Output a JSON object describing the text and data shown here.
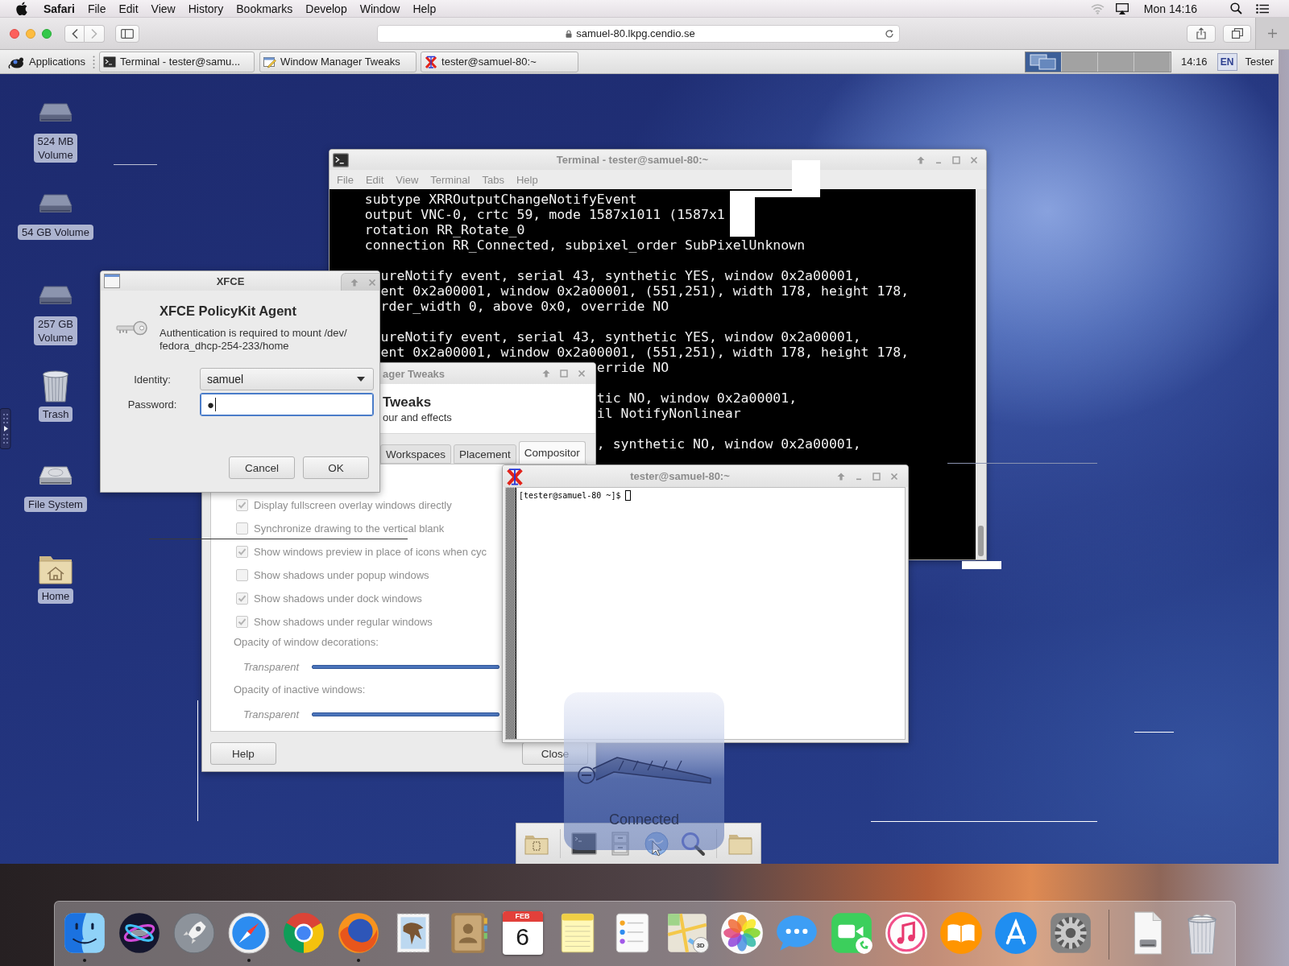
{
  "menu_bar": {
    "app": "Safari",
    "menus": [
      "File",
      "Edit",
      "View",
      "History",
      "Bookmarks",
      "Develop",
      "Window",
      "Help"
    ],
    "clock": "Mon 14:16"
  },
  "browser": {
    "address": "samuel-80.lkpg.cendio.se"
  },
  "xfce_panel": {
    "menu_label": "Applications",
    "tasks": [
      {
        "label": "Terminal - tester@samu...",
        "kind": "terminal"
      },
      {
        "label": "Window Manager Tweaks",
        "kind": "tweaks"
      },
      {
        "label": "tester@samuel-80:~",
        "kind": "xterm"
      }
    ],
    "workspaces": [
      {
        "selected": true
      },
      {
        "selected": false
      },
      {
        "selected": false
      },
      {
        "selected": false
      }
    ],
    "clock": "14:16",
    "keyboard_layout": "EN",
    "user": "Tester"
  },
  "desktop_icons": [
    {
      "label": "524 MB\nVolume",
      "kind": "drive"
    },
    {
      "label": "54 GB Volume",
      "kind": "drive"
    },
    {
      "label": "257 GB\nVolume",
      "kind": "drive"
    },
    {
      "label": "Trash",
      "kind": "trash"
    },
    {
      "label": "File System",
      "kind": "disk"
    },
    {
      "label": "Home",
      "kind": "home"
    }
  ],
  "terminal": {
    "title": "Terminal - tester@samuel-80:~",
    "active": false,
    "menus": [
      "File",
      "Edit",
      "View",
      "Terminal",
      "Tabs",
      "Help"
    ],
    "lines": [
      {
        "kind": "indented",
        "text": "subtype XRROutputChangeNotifyEvent"
      },
      {
        "kind": "indented",
        "text": "output VNC-0, crtc 59, mode 1587x1011 (1587x1"
      },
      {
        "kind": "indented",
        "text": "rotation RR_Rotate_0"
      },
      {
        "kind": "indented",
        "text": "connection RR_Connected, subpixel_order SubPixelUnknown"
      },
      {
        "kind": "blank"
      },
      {
        "kind": "clipped",
        "text": "ureNotify event, serial 43, synthetic YES, window 0x2a00001,"
      },
      {
        "kind": "clipped",
        "text": "ent 0x2a00001, window 0x2a00001, (551,251), width 178, height 178,"
      },
      {
        "kind": "clipped",
        "text": "rder_width 0, above 0x0, override NO"
      },
      {
        "kind": "blank"
      },
      {
        "kind": "clipped",
        "text": "ureNotify event, serial 43, synthetic YES, window 0x2a00001,"
      },
      {
        "kind": "clipped",
        "text": "ent 0x2a00001, window 0x2a00001, (551,251), width 178, height 178,"
      },
      {
        "kind": "tail",
        "text": "erride NO"
      },
      {
        "kind": "blank"
      },
      {
        "kind": "tail",
        "text": "tic NO, window 0x2a00001,"
      },
      {
        "kind": "tail",
        "text": "il NotifyNonlinear"
      },
      {
        "kind": "blank"
      },
      {
        "kind": "tail",
        "text": ", synthetic NO, window 0x2a00001,"
      }
    ]
  },
  "policykit_dialog": {
    "title": "XFCE",
    "active": true,
    "heading": "XFCE PolicyKit Agent",
    "message": "Authentication is required to mount /dev/\nfedora_dhcp-254-233/home",
    "fields": [
      {
        "label": "Identity:",
        "value": "samuel",
        "kind": "combo",
        "focused": false
      },
      {
        "label": "Password:",
        "value": "●",
        "kind": "password",
        "focused": true
      }
    ],
    "buttons": [
      "Cancel",
      "OK"
    ]
  },
  "tweaks_window": {
    "title": "ager Tweaks",
    "active": false,
    "heading": "Tweaks",
    "subheading": "our and effects",
    "tabs": [
      {
        "label": "Workspaces",
        "selected": false
      },
      {
        "label": "Placement",
        "selected": false
      },
      {
        "label": "Compositor",
        "selected": true
      }
    ],
    "options": [
      {
        "label": "Display fullscreen overlay windows directly",
        "checked": true,
        "disabled": true
      },
      {
        "label": "Synchronize drawing to the vertical blank",
        "checked": false,
        "disabled": true
      },
      {
        "label": "Show windows preview in place of icons when cyc",
        "checked": true,
        "disabled": true
      },
      {
        "label": "Show shadows under popup windows",
        "checked": false,
        "disabled": true
      },
      {
        "label": "Show shadows under dock windows",
        "checked": true,
        "disabled": true
      },
      {
        "label": "Show shadows under regular windows",
        "checked": true,
        "disabled": true
      }
    ],
    "sliders": [
      {
        "label": "Opacity of window decorations:",
        "min_label": "Transparent"
      },
      {
        "label": "Opacity of inactive windows:",
        "min_label": "Transparent"
      }
    ],
    "buttons": [
      "Help",
      "Close"
    ]
  },
  "xterm": {
    "title": "tester@samuel-80:~",
    "active": false,
    "prompt": "[tester@samuel-80 ~]$"
  },
  "vnc_notice": {
    "text": "Connected"
  },
  "launcher": {
    "items": [
      {
        "kind": "documents"
      },
      {
        "kind": "separator"
      },
      {
        "kind": "terminal"
      },
      {
        "kind": "cabinet"
      },
      {
        "kind": "browser"
      },
      {
        "kind": "search"
      },
      {
        "kind": "separator"
      },
      {
        "kind": "folder"
      }
    ]
  },
  "dock": {
    "items": [
      {
        "kind": "finder",
        "running": true
      },
      {
        "kind": "siri",
        "running": false
      },
      {
        "kind": "launchpad",
        "running": false
      },
      {
        "kind": "safari",
        "running": true
      },
      {
        "kind": "chrome",
        "running": false
      },
      {
        "kind": "firefox",
        "running": true
      },
      {
        "kind": "mail",
        "running": false
      },
      {
        "kind": "contacts",
        "running": false
      },
      {
        "kind": "calendar",
        "running": false,
        "month": "FEB",
        "day": "6"
      },
      {
        "kind": "notes",
        "running": false
      },
      {
        "kind": "reminders",
        "running": false
      },
      {
        "kind": "maps",
        "running": false,
        "badge": "3D"
      },
      {
        "kind": "photos",
        "running": false
      },
      {
        "kind": "messages",
        "running": false
      },
      {
        "kind": "facetime",
        "running": false
      },
      {
        "kind": "itunes",
        "running": false
      },
      {
        "kind": "ibooks",
        "running": false
      },
      {
        "kind": "appstore",
        "running": false
      },
      {
        "kind": "preferences",
        "running": false
      },
      {
        "kind": "separator"
      },
      {
        "kind": "document",
        "running": false
      },
      {
        "kind": "trash",
        "running": false
      }
    ]
  }
}
